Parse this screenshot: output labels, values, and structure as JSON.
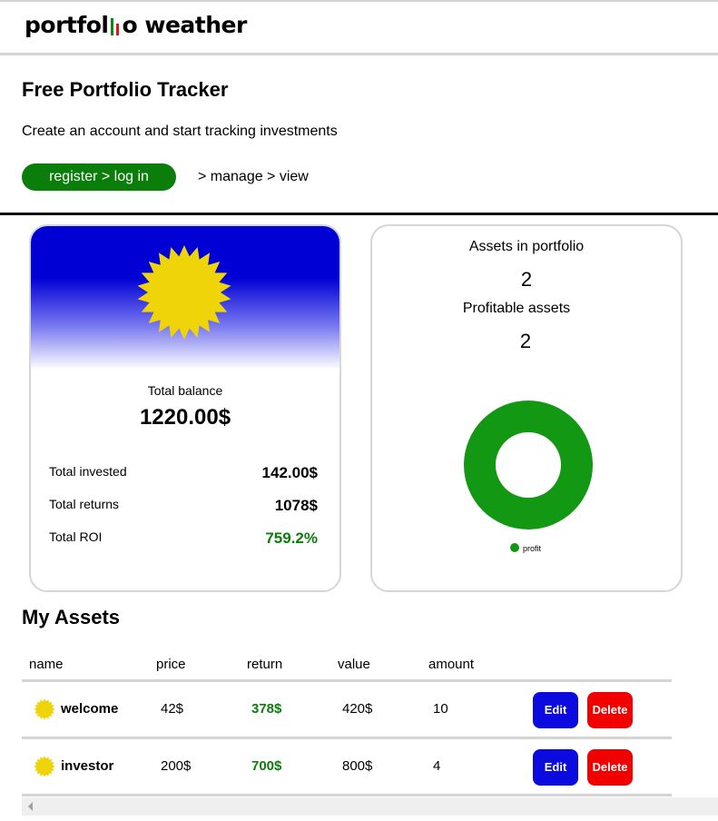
{
  "brand": {
    "prefix": "portfol",
    "suffix": "o weather"
  },
  "hero": {
    "title": "Free Portfolio Tracker",
    "subtitle": "Create an account and start tracking investments",
    "cta_label": "register > log in",
    "steps": "> manage > view"
  },
  "summary": {
    "total_balance_label": "Total balance",
    "total_balance": "1220.00$",
    "rows": [
      {
        "label": "Total invested",
        "value": "142.00$"
      },
      {
        "label": "Total returns",
        "value": "1078$"
      },
      {
        "label": "Total ROI",
        "value": "759.2%"
      }
    ]
  },
  "stats": {
    "assets_label": "Assets in portfolio",
    "assets_count": "2",
    "profitable_label": "Profitable assets",
    "profitable_count": "2"
  },
  "chart_data": {
    "type": "pie",
    "categories": [
      "profit"
    ],
    "values": [
      2
    ],
    "colors": [
      "#139813"
    ],
    "legend": "bottom"
  },
  "assets": {
    "title": "My Assets",
    "columns": [
      "name",
      "price",
      "return",
      "value",
      "amount"
    ],
    "edit_label": "Edit",
    "delete_label": "Delete",
    "rows": [
      {
        "name": "welcome",
        "price": "42$",
        "return": "378$",
        "value": "420$",
        "amount": "10"
      },
      {
        "name": "investor",
        "price": "200$",
        "return": "700$",
        "value": "800$",
        "amount": "4"
      }
    ]
  },
  "colors": {
    "accent_green": "#0a7d0a",
    "edit_blue": "#0b0be0",
    "delete_red": "#f20000",
    "sun_yellow": "#f0d40a",
    "sky_blue": "#0000d4"
  },
  "icons": {
    "sun": "sun-icon",
    "logo_bars": "chart-bars-icon",
    "scroll_left": "arrow-left-icon"
  }
}
